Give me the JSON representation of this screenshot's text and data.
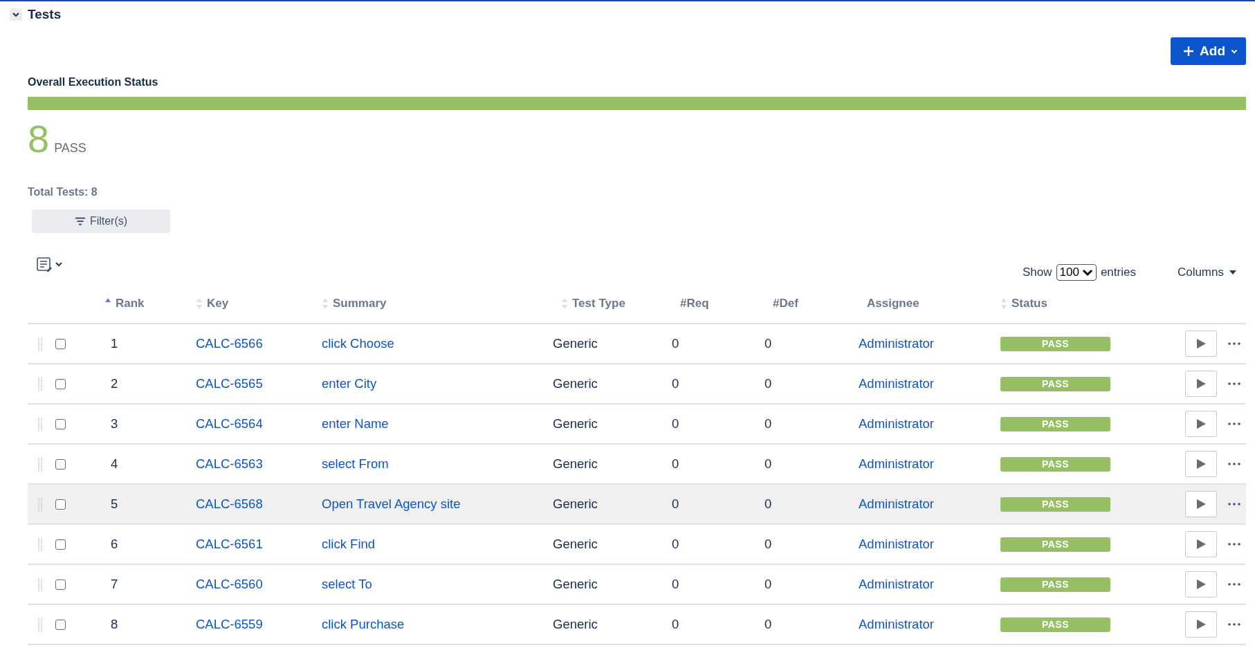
{
  "section": {
    "title": "Tests",
    "expanded": true
  },
  "add_button": {
    "label": "Add"
  },
  "overall": {
    "title": "Overall Execution Status",
    "level": 1,
    "count": "8",
    "status": "PASS"
  },
  "total": "Total Tests: 8",
  "filter_button": {
    "label": "Filter(s)"
  },
  "page_size": {
    "show": "Show",
    "value": "100",
    "entries": "entries"
  },
  "columns_button": {
    "label": "Columns"
  },
  "table": {
    "columns": [
      {
        "label": "Rank",
        "sorted": true
      },
      {
        "label": "Key",
        "sorted": false
      },
      {
        "label": "Summary",
        "sorted": false
      },
      {
        "label": "Test Type",
        "sorted": false
      },
      {
        "label": "#Req"
      },
      {
        "label": "#Def"
      },
      {
        "label": "Assignee"
      },
      {
        "label": "Status",
        "sorted": false
      }
    ],
    "rows": [
      {
        "rank": "1",
        "key": "CALC-6566",
        "summary": "click Choose",
        "type": "Generic",
        "req": "0",
        "def": "0",
        "assignee": "Administrator",
        "status": "PASS",
        "checked": false,
        "highlighted": false
      },
      {
        "rank": "2",
        "key": "CALC-6565",
        "summary": "enter City",
        "type": "Generic",
        "req": "0",
        "def": "0",
        "assignee": "Administrator",
        "status": "PASS",
        "checked": false,
        "highlighted": false
      },
      {
        "rank": "3",
        "key": "CALC-6564",
        "summary": "enter Name",
        "type": "Generic",
        "req": "0",
        "def": "0",
        "assignee": "Administrator",
        "status": "PASS",
        "checked": false,
        "highlighted": false
      },
      {
        "rank": "4",
        "key": "CALC-6563",
        "summary": "select From",
        "type": "Generic",
        "req": "0",
        "def": "0",
        "assignee": "Administrator",
        "status": "PASS",
        "checked": false,
        "highlighted": false
      },
      {
        "rank": "5",
        "key": "CALC-6568",
        "summary": "Open Travel Agency site",
        "type": "Generic",
        "req": "0",
        "def": "0",
        "assignee": "Administrator",
        "status": "PASS",
        "checked": false,
        "highlighted": true
      },
      {
        "rank": "6",
        "key": "CALC-6561",
        "summary": "click Find",
        "type": "Generic",
        "req": "0",
        "def": "0",
        "assignee": "Administrator",
        "status": "PASS",
        "checked": false,
        "highlighted": false
      },
      {
        "rank": "7",
        "key": "CALC-6560",
        "summary": "select To",
        "type": "Generic",
        "req": "0",
        "def": "0",
        "assignee": "Administrator",
        "status": "PASS",
        "checked": false,
        "highlighted": false
      },
      {
        "rank": "8",
        "key": "CALC-6559",
        "summary": "click Purchase",
        "type": "Generic",
        "req": "0",
        "def": "0",
        "assignee": "Administrator",
        "status": "PASS",
        "checked": false,
        "highlighted": false
      }
    ]
  }
}
